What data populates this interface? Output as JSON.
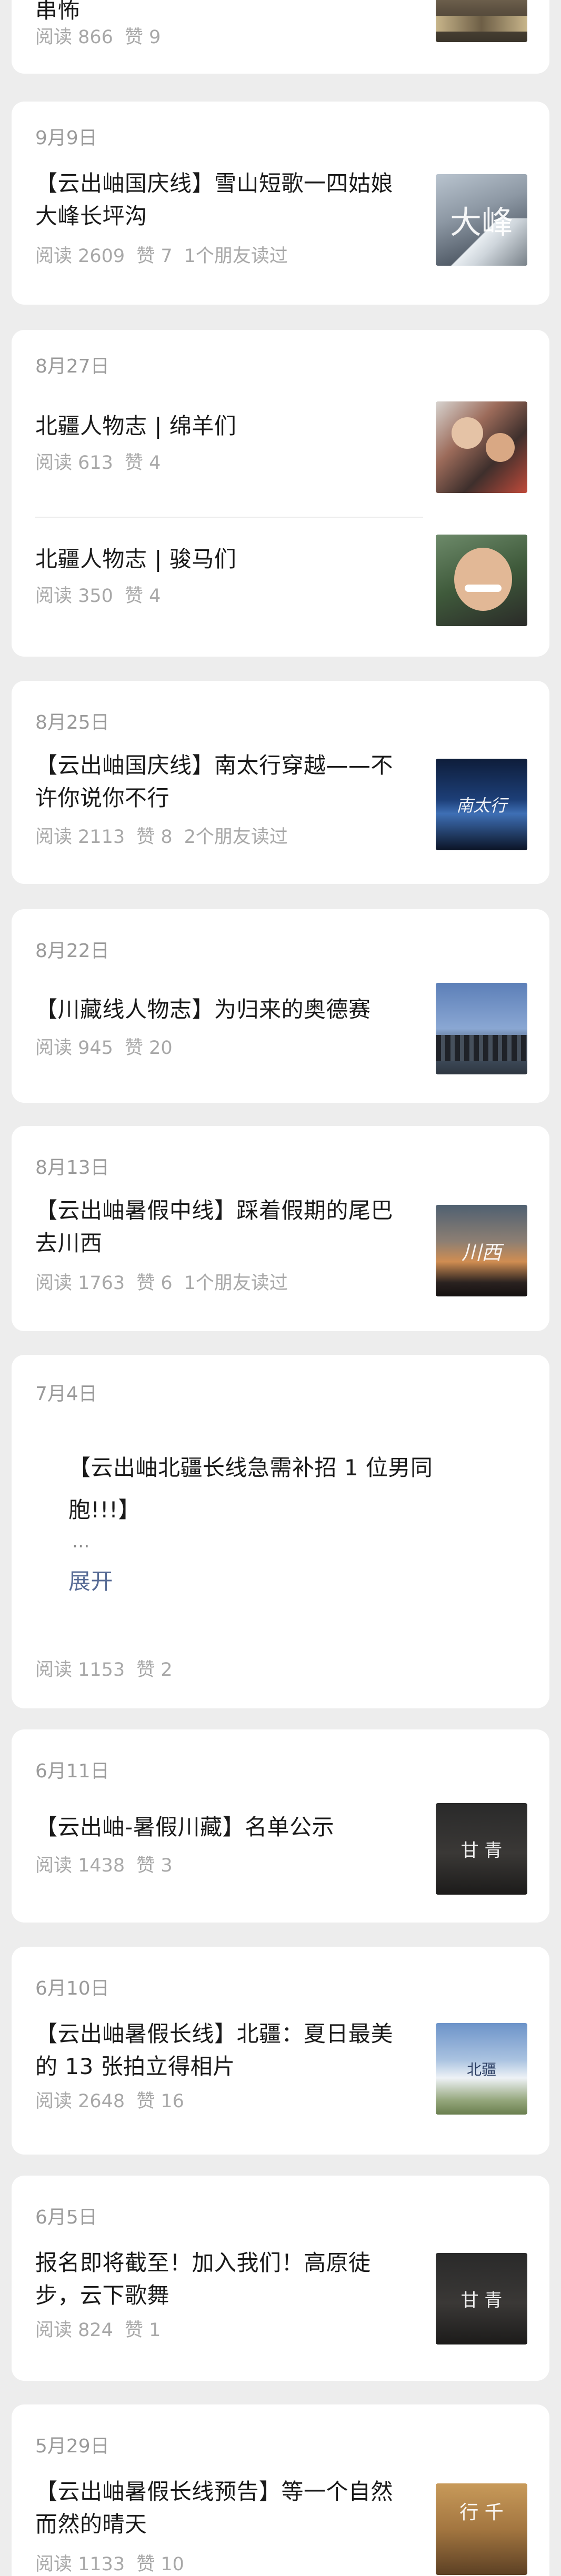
{
  "cards": [
    {
      "items": [
        {
          "title": "串怖",
          "read_label": "阅读 866",
          "like_label": "赞 9",
          "friends_label": "",
          "thumb_icon": "mountain-road-photo"
        }
      ]
    },
    {
      "date": "9月9日",
      "items": [
        {
          "title": "【云出岫国庆线】雪山短歌一四姑娘大峰长坪沟",
          "read_label": "阅读 2609",
          "like_label": "赞 7",
          "friends_label": "1个朋友读过",
          "thumb_text": "大峰",
          "thumb_icon": "snow-mountain-photo"
        }
      ]
    },
    {
      "date": "8月27日",
      "items": [
        {
          "title": "北疆人物志 | 绵羊们",
          "read_label": "阅读 613",
          "like_label": "赞 4",
          "friends_label": "",
          "thumb_icon": "group-selfie-photo"
        },
        {
          "title": "北疆人物志 | 骏马们",
          "read_label": "阅读 350",
          "like_label": "赞 4",
          "friends_label": "",
          "thumb_icon": "portrait-photo"
        }
      ]
    },
    {
      "date": "8月25日",
      "items": [
        {
          "title": "【云出岫国庆线】南太行穿越——不许你说你不行",
          "read_label": "阅读 2113",
          "like_label": "赞 8",
          "friends_label": "2个朋友读过",
          "thumb_text": "南太行",
          "thumb_icon": "mountain-lake-photo"
        }
      ]
    },
    {
      "date": "8月22日",
      "items": [
        {
          "title": "【川藏线人物志】为归来的奥德赛",
          "read_label": "阅读 945",
          "like_label": "赞 20",
          "friends_label": "",
          "thumb_icon": "group-sky-photo"
        }
      ]
    },
    {
      "date": "8月13日",
      "items": [
        {
          "title": "【云出岫暑假中线】踩着假期的尾巴去川西",
          "read_label": "阅读 1763",
          "like_label": "赞 6",
          "friends_label": "1个朋友读过",
          "thumb_text": "川西",
          "thumb_icon": "sunset-photo"
        }
      ]
    },
    {
      "date": "7月4日",
      "text_post": {
        "text": "【云出岫北疆长线急需补招 1 位男同胞!!!】",
        "ellipsis": "...",
        "expand": "展开"
      },
      "read_label": "阅读 1153",
      "like_label": "赞 2"
    },
    {
      "date": "6月11日",
      "items": [
        {
          "title": "【云出岫-暑假川藏】名单公示",
          "read_label": "阅读 1438",
          "like_label": "赞 3",
          "friends_label": "",
          "thumb_text": "甘 青",
          "thumb_icon": "dark-feet-photo"
        }
      ]
    },
    {
      "date": "6月10日",
      "items": [
        {
          "title": "【云出岫暑假长线】北疆：夏日最美的 13 张拍立得相片",
          "read_label": "阅读 2648",
          "like_label": "赞 16",
          "friends_label": "",
          "thumb_text": "北疆",
          "thumb_icon": "snow-field-photo"
        }
      ]
    },
    {
      "date": "6月5日",
      "items": [
        {
          "title": "报名即将截至！加入我们！高原徒步，云下歌舞",
          "read_label": "阅读 824",
          "like_label": "赞 1",
          "friends_label": "",
          "thumb_text": "甘 青",
          "thumb_icon": "dark-feet-photo"
        }
      ]
    },
    {
      "date": "5月29日",
      "items": [
        {
          "title": "【云出岫暑假长线预告】等一个自然而然的晴天",
          "read_label": "阅读 1133",
          "like_label": "赞 10",
          "friends_label": "",
          "thumb_text": "行 千",
          "thumb_icon": "golden-landscape-photo"
        }
      ]
    }
  ]
}
